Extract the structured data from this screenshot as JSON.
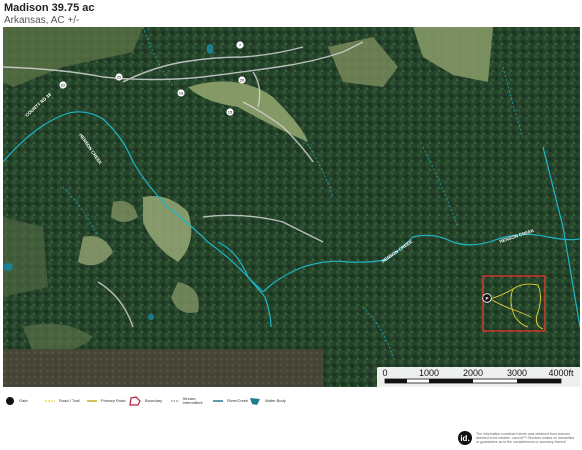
{
  "header": {
    "title": "Madison 39.75 ac",
    "subtitle": "Arkansas,  AC +/-"
  },
  "map": {
    "labels": {
      "road_county": "COUNTY RD 38",
      "creek_1": "HENSON CREEK",
      "creek_2": "HENSON CREEK",
      "creek_3": "HENSON CREEK"
    },
    "road_markers": [
      "7",
      "25",
      "22",
      "20",
      "19",
      "15",
      "15",
      "19",
      "20"
    ],
    "gate_marker": "P",
    "scale": {
      "labels": [
        "0",
        "1000",
        "2000",
        "3000",
        "4000ft"
      ]
    },
    "colors": {
      "creek": "#1fb6c9",
      "boundary": "#e8382e",
      "trail": "#e6d53a",
      "road": "#d9d9d9",
      "water_body": "#1c7f8d"
    }
  },
  "legend": {
    "items": [
      {
        "label": "Gate",
        "icon": "gate-icon"
      },
      {
        "label": "Road / Trail",
        "icon": "trail-line-icon"
      },
      {
        "label": "Primary Road",
        "icon": "primary-road-icon"
      },
      {
        "label": "Boundary",
        "icon": "boundary-icon"
      },
      {
        "label": "Stream, Intermittent",
        "icon": "stream-intermittent-icon"
      },
      {
        "label": "River/Creek",
        "icon": "river-creek-icon"
      },
      {
        "label": "Water Body",
        "icon": "water-body-icon"
      }
    ]
  },
  "footer": {
    "logo": "id.",
    "disclaimer": "The information contained herein was obtained from sources deemed to be reliable. Land id™ Services makes no warranties or guarantees as to the completeness or accuracy thereof."
  }
}
